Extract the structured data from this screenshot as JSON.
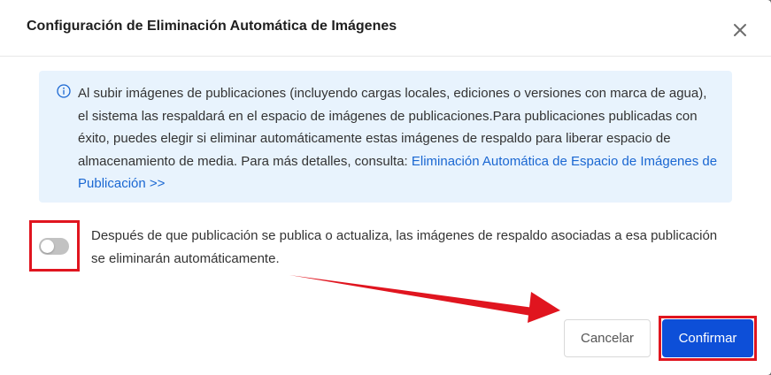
{
  "dialog": {
    "title": "Configuración de Eliminación Automática de Imágenes",
    "close_icon": "close-icon"
  },
  "info": {
    "icon": "info-icon",
    "text": "Al subir imágenes de publicaciones (incluyendo cargas locales, ediciones o versiones con marca de agua), el sistema las respaldará en el espacio de imágenes de publicaciones.Para publicaciones publicadas con éxito, puedes elegir si eliminar automáticamente estas imágenes de respaldo para liberar espacio de almacenamiento de media. Para más detalles, consulta: ",
    "link": "Eliminación Automática de Espacio de Imágenes de Publicación >>"
  },
  "setting": {
    "toggle_on": false,
    "label": "Después de que publicación se publica o actualiza, las imágenes de respaldo asociadas a esa publicación se eliminarán automáticamente."
  },
  "footer": {
    "cancel_label": "Cancelar",
    "confirm_label": "Confirmar"
  },
  "colors": {
    "accent": "#0d4fd8",
    "info_bg": "#e8f3fd",
    "link": "#1a67d2",
    "annotation_red": "#e0151f",
    "toggle_off": "#c2c2c2"
  }
}
